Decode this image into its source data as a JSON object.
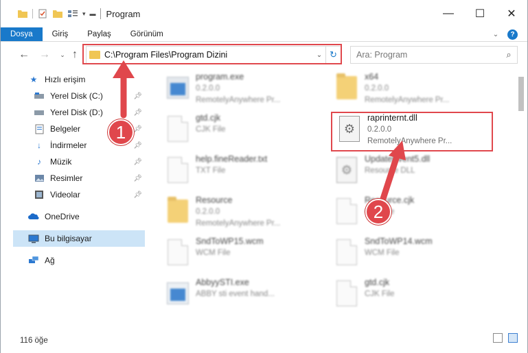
{
  "window": {
    "title": "Program",
    "controls": {
      "minimize": "—",
      "maximize": "☐",
      "close": "✕"
    }
  },
  "ribbon": {
    "tabs": [
      "Dosya",
      "Giriş",
      "Paylaş",
      "Görünüm"
    ],
    "active_tab": "Dosya",
    "help": "?"
  },
  "navigation": {
    "address_path": "C:\\Program Files\\Program Dizini",
    "search_placeholder": "Ara: Program"
  },
  "sidebar": {
    "items": [
      {
        "label": "Hızlı erişim",
        "icon": "star-icon"
      },
      {
        "label": "Yerel Disk (C:)",
        "icon": "drive-icon"
      },
      {
        "label": "Yerel Disk (D:)",
        "icon": "drive-icon"
      },
      {
        "label": "Belgeler",
        "icon": "documents-icon"
      },
      {
        "label": "İndirmeler",
        "icon": "download-icon"
      },
      {
        "label": "Müzik",
        "icon": "music-icon"
      },
      {
        "label": "Resimler",
        "icon": "pictures-icon"
      },
      {
        "label": "Videolar",
        "icon": "video-icon"
      },
      {
        "label": "OneDrive",
        "icon": "cloud-icon"
      },
      {
        "label": "Bu bilgisayar",
        "icon": "computer-icon"
      },
      {
        "label": "Ağ",
        "icon": "network-icon"
      }
    ],
    "selected": "Bu bilgisayar"
  },
  "files": [
    {
      "name": "program.exe",
      "line2": "0.2.0.0",
      "line3": "RemotelyAnywhere Pr...",
      "icon": "exe-icon"
    },
    {
      "name": "x64",
      "line2": "0.2.0.0",
      "line3": "RemotelyAnywhere Pr...",
      "icon": "folder-icon"
    },
    {
      "name": "gtd.cjk",
      "line2": "CJK File",
      "line3": "",
      "icon": "document-icon"
    },
    {
      "name": "raprinternt.dll",
      "line2": "0.2.0.0",
      "line3": "RemotelyAnywhere Pr...",
      "icon": "dll-gear-icon"
    },
    {
      "name": "help.fineReader.txt",
      "line2": "TXT File",
      "line3": "",
      "icon": "document-icon"
    },
    {
      "name": "UpdateEvent5.dll",
      "line2": "Resource DLL",
      "line3": "",
      "icon": "dll-gear-icon"
    },
    {
      "name": "Resource",
      "line2": "0.2.0.0",
      "line3": "RemotelyAnywhere Pr...",
      "icon": "folder-icon"
    },
    {
      "name": "Resource.cjk",
      "line2": "CJK File",
      "line3": "",
      "icon": "document-icon"
    },
    {
      "name": "SndToWP15.wcm",
      "line2": "WCM File",
      "line3": "",
      "icon": "document-icon"
    },
    {
      "name": "SndToWP14.wcm",
      "line2": "WCM File",
      "line3": "",
      "icon": "document-icon"
    },
    {
      "name": "AbbyySTI.exe",
      "line2": "ABBY sti event hand...",
      "line3": "",
      "icon": "exe-icon"
    },
    {
      "name": "gtd.cjk",
      "line2": "CJK File",
      "line3": "",
      "icon": "document-icon"
    }
  ],
  "status": {
    "item_count": "116 öğe"
  },
  "annotations": {
    "step1": "1",
    "step2": "2",
    "color": "#e0474c"
  }
}
